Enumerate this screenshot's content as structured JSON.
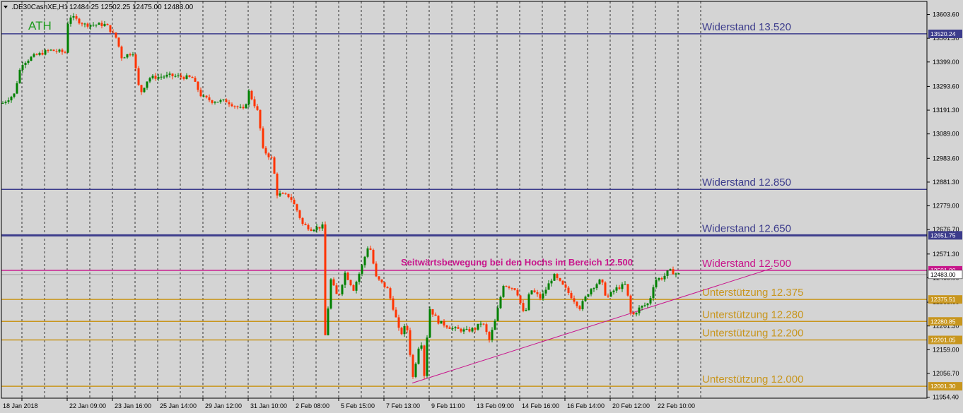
{
  "header": {
    "symbol": ".DE30CashXE,H1",
    "ohlc": "12484.25 12502.25 12475.00 12483.00"
  },
  "chart_data": {
    "type": "candlestick",
    "y_range": [
      11950,
      13660
    ],
    "y_ticks": [
      "13603.60",
      "13501.30",
      "13399.00",
      "13293.60",
      "13191.30",
      "13089.00",
      "12983.60",
      "12881.30",
      "12779.00",
      "12676.70",
      "12571.30",
      "12469.00",
      "12363.60",
      "12261.30",
      "12159.00",
      "12056.70",
      "11954.40"
    ],
    "x_labels": [
      "18 Jan 2018",
      "22 Jan 09:00",
      "23 Jan 16:00",
      "25 Jan 14:00",
      "29 Jan 12:00",
      "31 Jan 10:00",
      "2 Feb 08:00",
      "5 Feb 15:00",
      "7 Feb 13:00",
      "9 Feb 11:00",
      "13 Feb 09:00",
      "14 Feb 16:00",
      "16 Feb 14:00",
      "20 Feb 12:00",
      "22 Feb 10:00"
    ],
    "levels": [
      {
        "value": 13520.24,
        "text": "Widerstand 13.520",
        "tag": "13520.24",
        "color": "#3c3c8c"
      },
      {
        "value": 12850,
        "text": "Widerstand 12.850",
        "tag": "",
        "color": "#3c3c8c"
      },
      {
        "value": 12651.75,
        "text": "Widerstand 12.650",
        "tag": "12651.75",
        "color": "#3c3c8c"
      },
      {
        "value": 12501.0,
        "text": "Widerstand 12.500",
        "tag": "12501.00",
        "color": "#c8168c"
      },
      {
        "value": 12375.51,
        "text": "Unterstützung 12.375",
        "tag": "12375.51",
        "color": "#c8961e"
      },
      {
        "value": 12280.85,
        "text": "Unterstützung 12.280",
        "tag": "12280.85",
        "color": "#c8961e"
      },
      {
        "value": 12201.05,
        "text": "Unterstützung 12.200",
        "tag": "12201.05",
        "color": "#c8961e"
      },
      {
        "value": 12001.3,
        "text": "Unterstützung 12.000",
        "tag": "12001.30",
        "color": "#c8961e"
      }
    ],
    "current_price": {
      "value": 12483.0,
      "tag": "12483.00"
    },
    "annotations": {
      "ath": "ATH",
      "sideways": "Seitwärtsbewegung bei den Hochs im Bereich 12.500"
    },
    "trendline": {
      "from": [
        0,
        12015
      ],
      "to": [
        1,
        12510
      ]
    },
    "colors": {
      "bull": "#008000",
      "bear": "#ff3300",
      "grid": "#000000",
      "background": "#d4d4d4"
    }
  }
}
